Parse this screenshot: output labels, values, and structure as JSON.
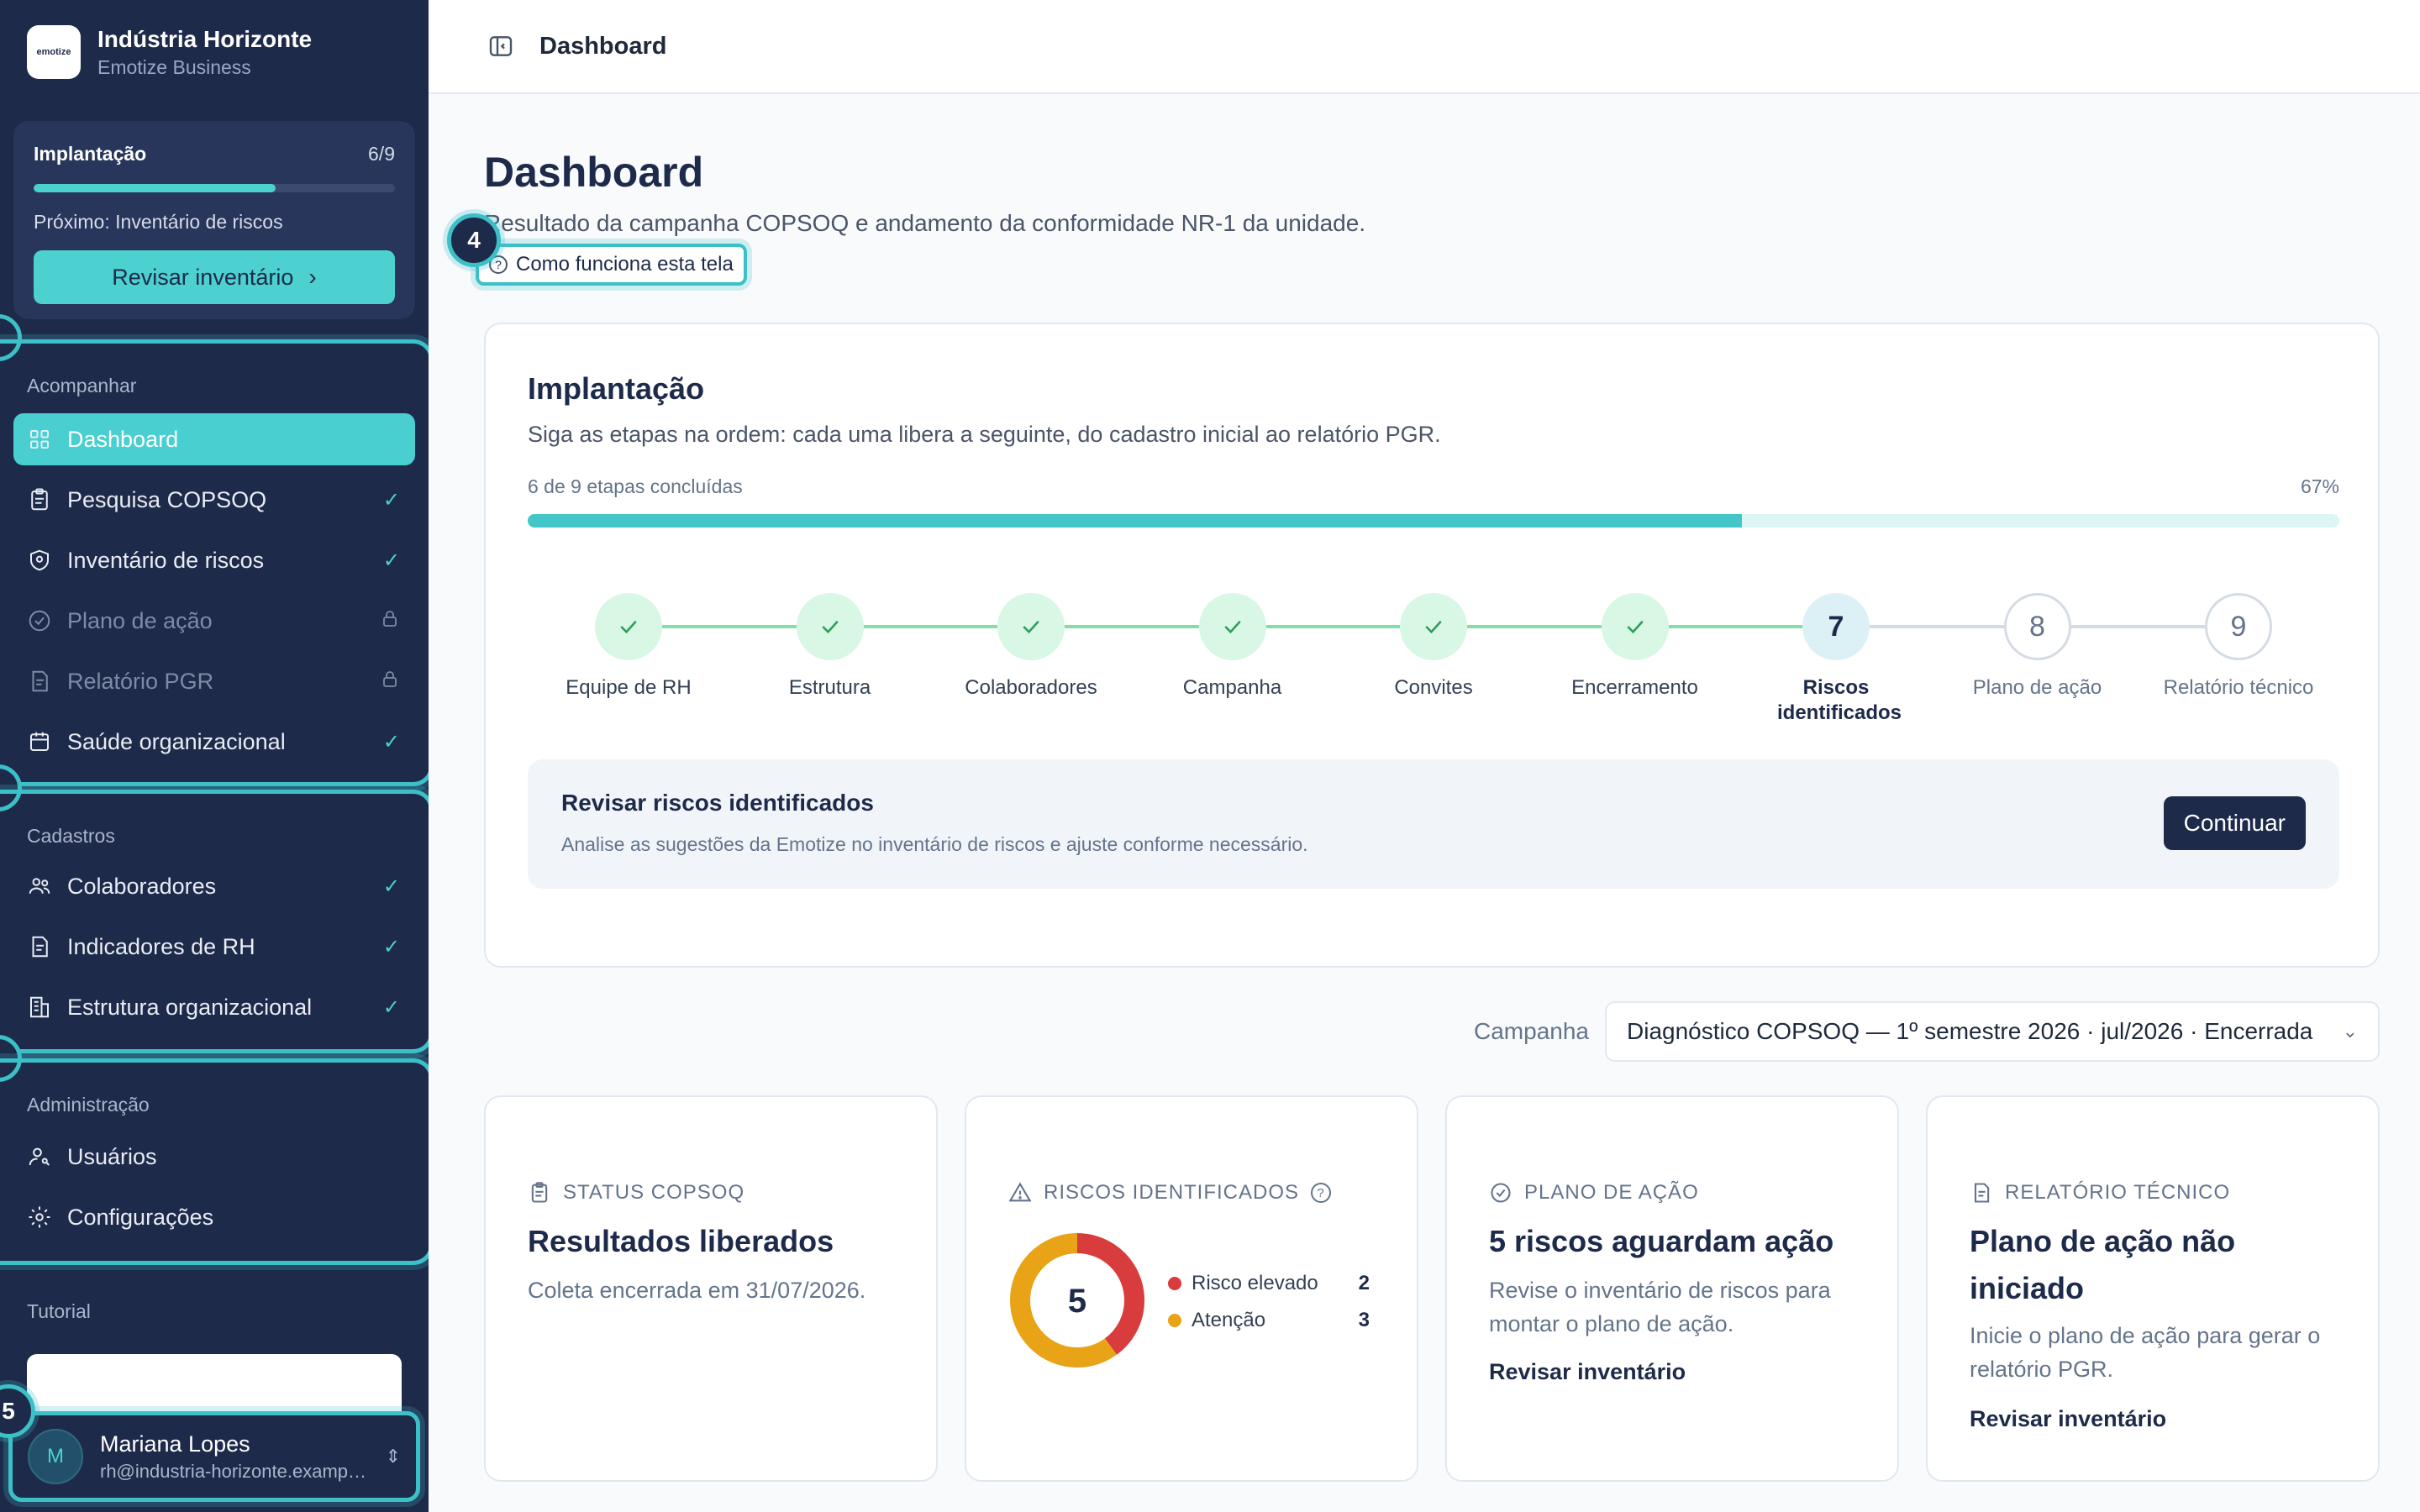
{
  "org": {
    "name": "Indústria Horizonte",
    "plan": "Emotize Business",
    "logo": "emotize"
  },
  "implantacao_widget": {
    "title": "Implantação",
    "count": "6/9",
    "progress": 0.67,
    "next": "Próximo: Inventário de riscos",
    "button": "Revisar inventário"
  },
  "nav": {
    "groups": [
      {
        "title": "Acompanhar",
        "items": [
          {
            "label": "Dashboard",
            "icon": "grid-icon",
            "status": "",
            "state": "active"
          },
          {
            "label": "Pesquisa COPSOQ",
            "icon": "clipboard-icon",
            "status": "✓",
            "state": "done"
          },
          {
            "label": "Inventário de riscos",
            "icon": "shield-icon",
            "status": "✓",
            "state": "done"
          },
          {
            "label": "Plano de ação",
            "icon": "check-circle-icon",
            "status": "lock",
            "state": "locked"
          },
          {
            "label": "Relatório PGR",
            "icon": "document-icon",
            "status": "lock",
            "state": "locked"
          },
          {
            "label": "Saúde organizacional",
            "icon": "calendar-icon",
            "status": "✓",
            "state": "done"
          }
        ]
      },
      {
        "title": "Cadastros",
        "items": [
          {
            "label": "Colaboradores",
            "icon": "users-icon",
            "status": "✓",
            "state": "done"
          },
          {
            "label": "Indicadores de RH",
            "icon": "document-icon",
            "status": "✓",
            "state": "done"
          },
          {
            "label": "Estrutura organizacional",
            "icon": "building-icon",
            "status": "✓",
            "state": "done"
          }
        ]
      },
      {
        "title": "Administração",
        "items": [
          {
            "label": "Usuários",
            "icon": "user-key-icon",
            "status": "",
            "state": "normal"
          },
          {
            "label": "Configurações",
            "icon": "gear-icon",
            "status": "",
            "state": "normal"
          }
        ]
      }
    ]
  },
  "tutorial": {
    "title": "Tutorial"
  },
  "user": {
    "initial": "M",
    "name": "Mariana Lopes",
    "email": "rh@industria-horizonte.example.com"
  },
  "tour_badges": {
    "help": "4",
    "user": "5"
  },
  "topbar": {
    "title": "Dashboard"
  },
  "page": {
    "title": "Dashboard",
    "subtitle": "Resultado da campanha COPSOQ e andamento da conformidade NR-1 da unidade.",
    "help_button": "Como funciona esta tela"
  },
  "implantacao_card": {
    "title": "Implantação",
    "subtitle": "Siga as etapas na ordem: cada uma libera a seguinte, do cadastro inicial ao relatório PGR.",
    "progress_label": "6 de 9 etapas concluídas",
    "progress_pct": "67%",
    "progress": 0.67,
    "steps": [
      {
        "n": "1",
        "label": "Equipe de RH",
        "state": "done"
      },
      {
        "n": "2",
        "label": "Estrutura",
        "state": "done"
      },
      {
        "n": "3",
        "label": "Colaboradores",
        "state": "done"
      },
      {
        "n": "4",
        "label": "Campanha",
        "state": "done"
      },
      {
        "n": "5",
        "label": "Convites",
        "state": "done"
      },
      {
        "n": "6",
        "label": "Encerramento",
        "state": "done"
      },
      {
        "n": "7",
        "label": "Riscos identificados",
        "state": "current"
      },
      {
        "n": "8",
        "label": "Plano de ação",
        "state": "todo"
      },
      {
        "n": "9",
        "label": "Relatório técnico",
        "state": "todo"
      }
    ],
    "next": {
      "title": "Revisar riscos identificados",
      "desc": "Analise as sugestões da Emotize no inventário de riscos e ajuste conforme necessário.",
      "button": "Continuar"
    }
  },
  "campaign": {
    "label": "Campanha",
    "selected": "Diagnóstico COPSOQ — 1º semestre 2026 · jul/2026 · Encerrada"
  },
  "kpis": {
    "status": {
      "label": "STATUS COPSOQ",
      "title": "Resultados liberados",
      "desc": "Coleta encerrada em 31/07/2026."
    },
    "riscos": {
      "label": "RISCOS IDENTIFICADOS",
      "total": "5",
      "legend": [
        {
          "name": "Risco elevado",
          "value": 2,
          "color": "#d93c3c"
        },
        {
          "name": "Atenção",
          "value": 3,
          "color": "#e8a317"
        }
      ]
    },
    "plano": {
      "label": "PLANO DE AÇÃO",
      "title": "5 riscos aguardam ação",
      "desc": "Revise o inventário de riscos para montar o plano de ação.",
      "link": "Revisar inventário"
    },
    "relatorio": {
      "label": "RELATÓRIO TÉCNICO",
      "title": "Plano de ação não iniciado",
      "desc": "Inicie o plano de ação para gerar o relatório PGR.",
      "link": "Revisar inventário"
    }
  },
  "colors": {
    "accent": "#4dd0d0",
    "sidebar": "#1e2a4a",
    "done": "#2f9c5a"
  }
}
